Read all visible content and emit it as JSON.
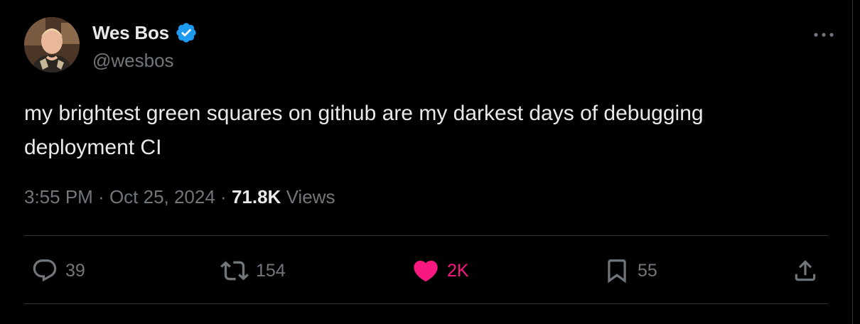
{
  "author": {
    "display_name": "Wes Bos",
    "handle": "@wesbos",
    "verified": true,
    "avatar_icon": "profile-photo"
  },
  "more_icon": "more-horizontal-icon",
  "tweet": {
    "text": "my brightest green squares on github are my darkest days of debugging\ndeployment CI"
  },
  "meta": {
    "time": "3:55 PM",
    "separator": " · ",
    "date": "Oct 25, 2024",
    "views_count": "71.8K",
    "views_label": "Views"
  },
  "actions": {
    "replies": {
      "icon": "reply-icon",
      "count": "39"
    },
    "reposts": {
      "icon": "repost-icon",
      "count": "154"
    },
    "likes": {
      "icon": "heart-icon",
      "count": "2K",
      "liked": true
    },
    "bookmarks": {
      "icon": "bookmark-icon",
      "count": "55"
    },
    "share": {
      "icon": "share-icon"
    }
  },
  "colors": {
    "background": "#000000",
    "text": "#e7e9ea",
    "muted": "#71767b",
    "divider": "#2f3336",
    "verified": "#1d9bf0",
    "like": "#f91880"
  }
}
